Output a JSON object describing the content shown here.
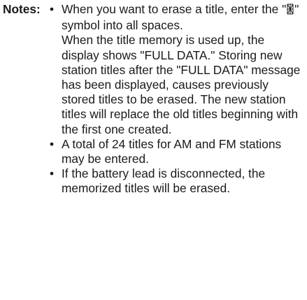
{
  "notes": {
    "label": "Notes:",
    "items": [
      {
        "text_before": "When you want to erase a title, enter the \"",
        "symbol_icon": "segment-display-blank-symbol-icon",
        "text_after": "\" symbol into all spaces.",
        "extra": "When the title memory is used up, the display shows \"FULL DATA.\" Storing new station titles after the \"FULL DATA\" message has been displayed, causes previously stored titles to be erased. The new station titles will replace the old titles beginning with the first one created."
      },
      {
        "text": "A total of 24 titles for AM and FM stations may be entered."
      },
      {
        "text": "If the battery lead is disconnected, the memorized titles will be erased."
      }
    ]
  }
}
